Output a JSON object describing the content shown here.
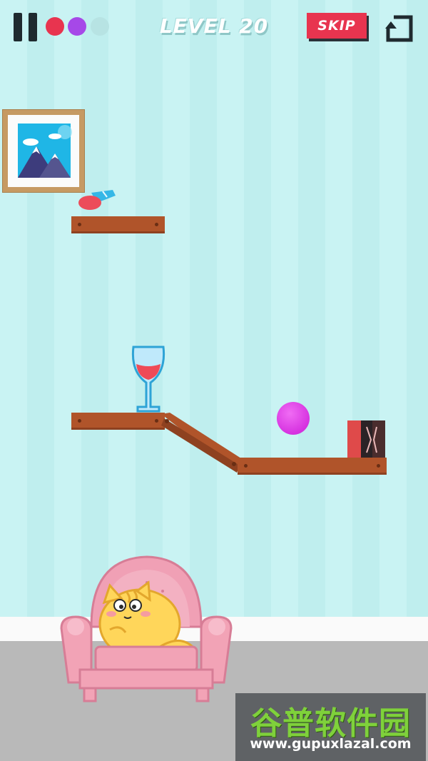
{
  "hud": {
    "level_label": "LEVEL 20",
    "skip_label": "SKIP",
    "balls": [
      {
        "color": "#e8344f",
        "state": "available"
      },
      {
        "color": "#a648e8",
        "state": "available"
      },
      {
        "color": "#b7e3e3",
        "state": "used"
      }
    ]
  },
  "scene": {
    "wall_color": "#c9f3f3",
    "floor_color": "#b9b9b9",
    "ball_color": "#d632e0",
    "wine_color": "#ef4a57",
    "plank_color": "#b0542a",
    "sofa_color": "#f2a3b6",
    "cat_color": "#ffd65a"
  },
  "watermark": {
    "chinese": "谷普软件园",
    "url": "www.gupuxlazal.com"
  }
}
